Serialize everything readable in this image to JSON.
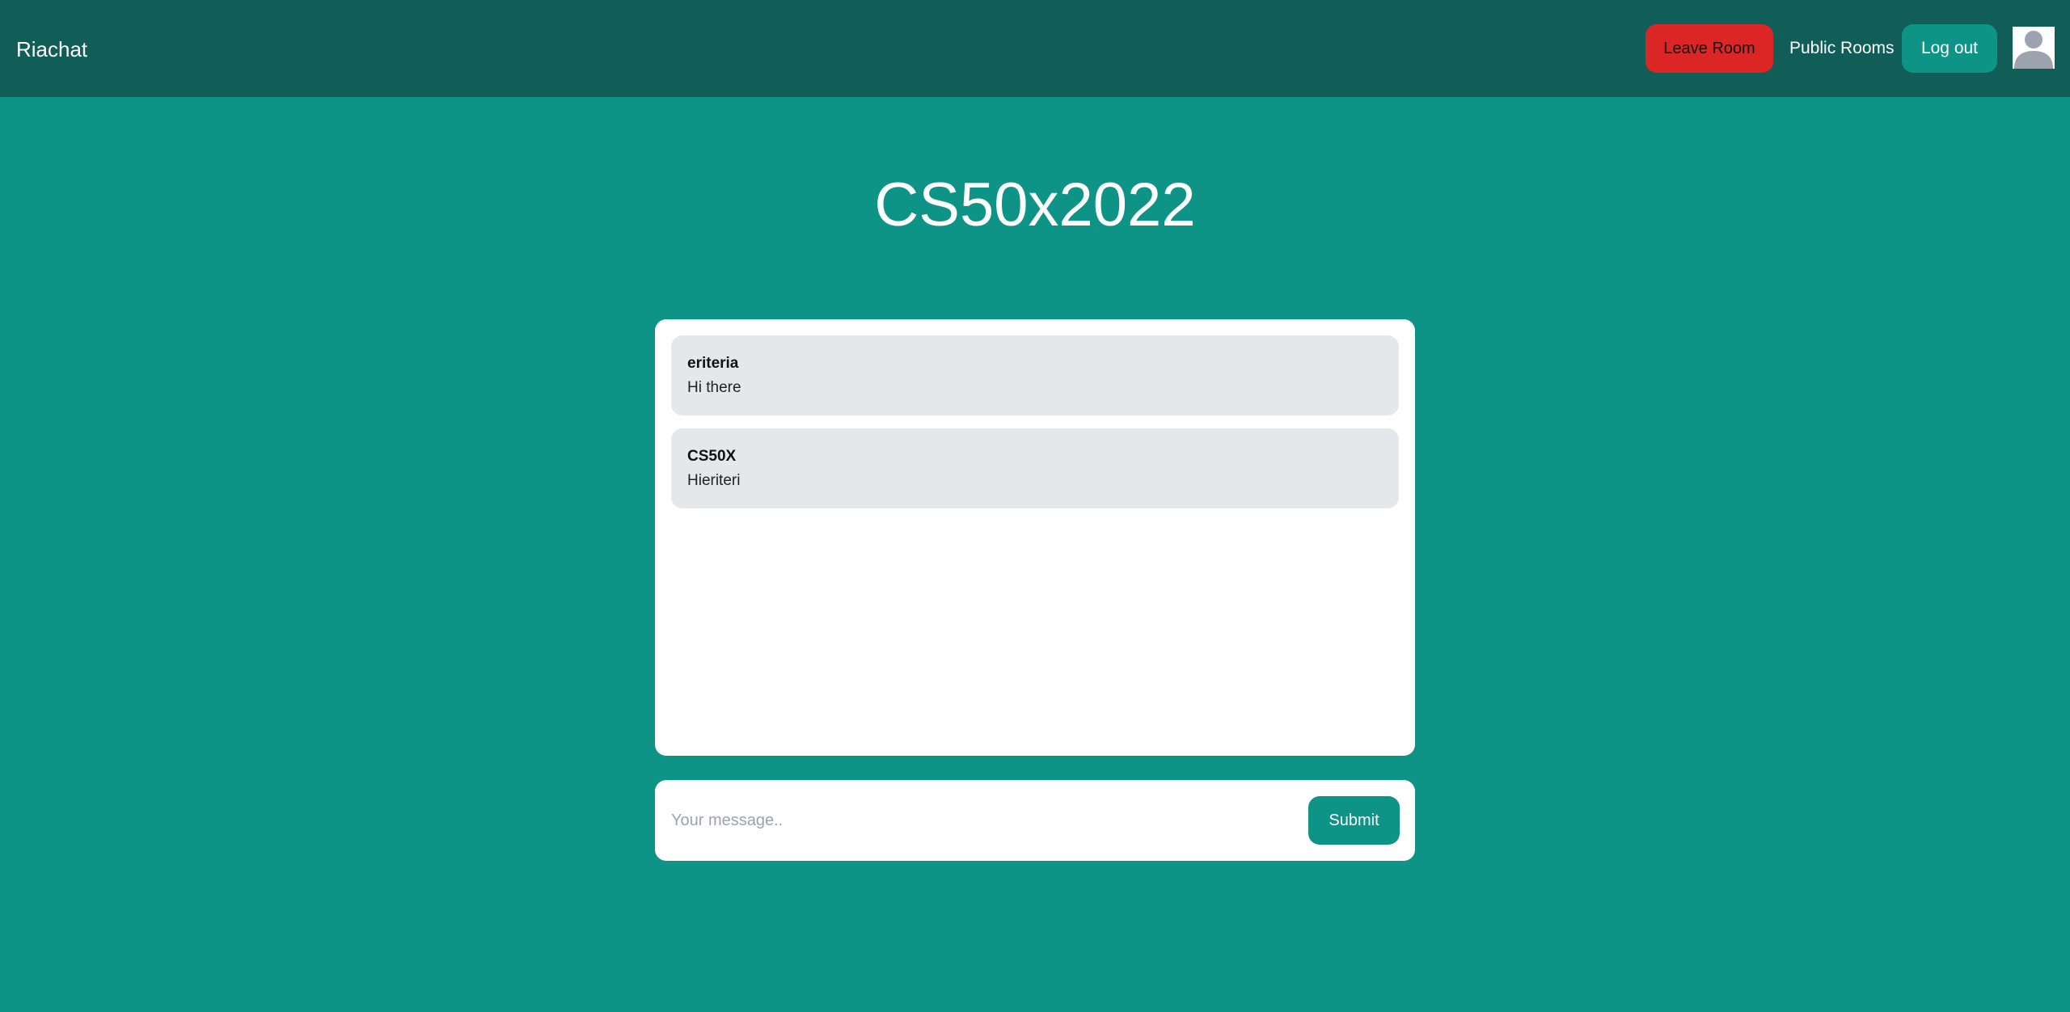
{
  "navbar": {
    "brand": "Riachat",
    "leave_room_label": "Leave Room",
    "public_rooms_label": "Public Rooms",
    "logout_label": "Log out",
    "avatar_icon": "user-avatar-icon"
  },
  "room": {
    "title": "CS50x2022"
  },
  "messages": [
    {
      "user": "eriteria",
      "text": "Hi there"
    },
    {
      "user": "CS50X",
      "text": "Hieriteri"
    }
  ],
  "composer": {
    "placeholder": "Your message..",
    "submit_label": "Submit"
  },
  "colors": {
    "background": "#0e9487",
    "navbar": "#115e59",
    "leave_button": "#dc2626",
    "message_bubble": "#e5e7eb"
  }
}
